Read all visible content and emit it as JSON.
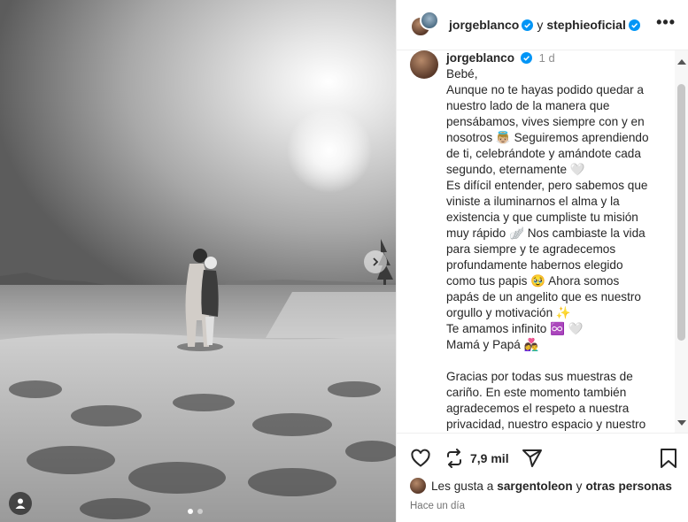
{
  "header": {
    "user1": "jorgeblanco",
    "connector": "y",
    "user2": "stephieoficial",
    "more_label": "•••"
  },
  "caption": {
    "username": "jorgeblanco",
    "time": "1 d",
    "lines": [
      "Bebé,",
      "Aunque no te hayas podido quedar a",
      "nuestro lado de la manera que",
      "pensábamos, vives siempre con y en",
      "nosotros 👼🏼 Seguiremos aprendiendo",
      "de ti, celebrándote y amándote cada",
      "segundo, eternamente 🤍",
      "Es difícil entender, pero sabemos que",
      "viniste a iluminarnos el alma y la",
      "existencia y que cumpliste tu misión",
      "muy rápido 🪽 Nos cambiaste la vida",
      "para siempre y te agradecemos",
      "profundamente habernos elegido",
      "como tus papis 🥹 Ahora somos",
      "papás de un angelito que es nuestro",
      "orgullo y motivación ✨",
      "Te amamos infinito ♾️ 🤍",
      "Mamá y Papá 👩‍❤️‍👨",
      "",
      "Gracias por todas sus muestras de",
      "cariño. En este momento también",
      "agradecemos el respeto a nuestra",
      "privacidad, nuestro espacio y nuestro"
    ]
  },
  "actions": {
    "reposts_count": "7,9 mil"
  },
  "likes": {
    "prefix": "Les gusta a",
    "user": "sargentoleon",
    "connector": "y",
    "others": "otras personas"
  },
  "timestamp": "Hace un día",
  "carousel": {
    "total": 2,
    "active_index": 1
  },
  "colors": {
    "verified": "#0095f6",
    "text": "#262626",
    "muted": "#737373"
  },
  "icons": [
    "heart-icon",
    "repost-icon",
    "share-icon",
    "bookmark-icon",
    "chevron-right-icon",
    "user-tag-icon",
    "verified-icon",
    "more-icon"
  ]
}
